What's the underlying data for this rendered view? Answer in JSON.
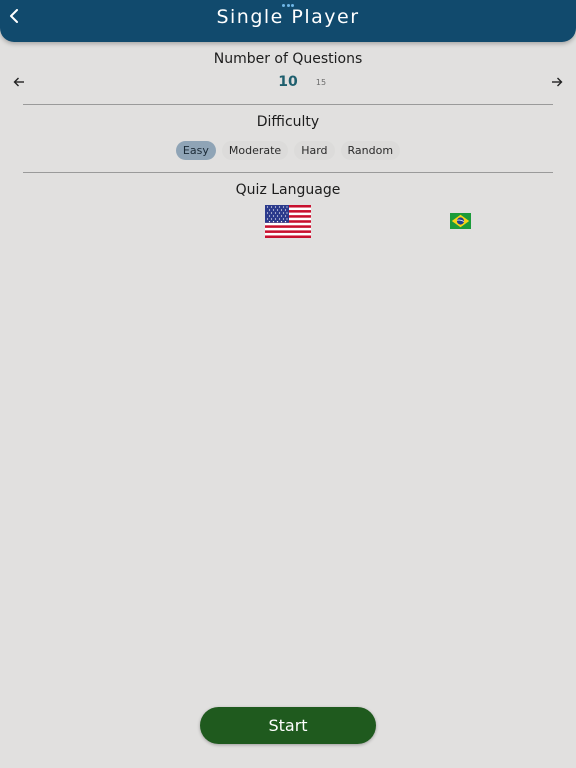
{
  "header": {
    "title": "Single Player",
    "back_icon": "chevron-left-icon",
    "more_icon": "more-dots-icon"
  },
  "questions": {
    "title": "Number of Questions",
    "current": "10",
    "next": "15",
    "prev_icon": "arrow-left-icon",
    "next_icon": "arrow-right-icon"
  },
  "difficulty": {
    "title": "Difficulty",
    "options": [
      "Easy",
      "Moderate",
      "Hard",
      "Random"
    ],
    "selected": "Easy"
  },
  "language": {
    "title": "Quiz Language",
    "flags": [
      "us-flag-icon",
      "brazil-flag-icon"
    ]
  },
  "start_label": "Start",
  "colors": {
    "header": "#114a6d",
    "background": "#e1e0df",
    "accent_number": "#1f5f6e",
    "pill_active": "#8fa4b6",
    "start_button": "#1f5a1e"
  }
}
